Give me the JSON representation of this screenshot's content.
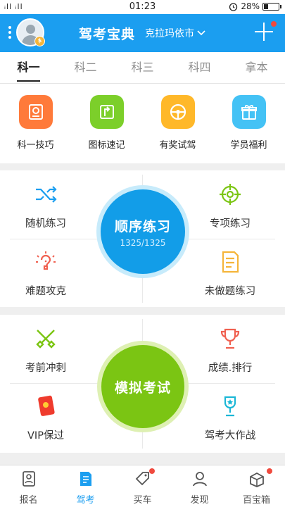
{
  "status": {
    "signal": "ᵢll ᵢll",
    "time": "01:23",
    "battery": "28%",
    "battery_level": 0.28
  },
  "header": {
    "title": "驾考宝典",
    "city": "克拉玛依市",
    "avatar_badge": "$"
  },
  "tabs": [
    {
      "label": "科一",
      "active": true
    },
    {
      "label": "科二"
    },
    {
      "label": "科三"
    },
    {
      "label": "科四"
    },
    {
      "label": "拿本"
    }
  ],
  "features": [
    {
      "label": "科一技巧",
      "icon": "book-icon",
      "color": "#ff7a3a"
    },
    {
      "label": "图标速记",
      "icon": "sign-icon",
      "color": "#7ccf2a"
    },
    {
      "label": "有奖试驾",
      "icon": "steering-icon",
      "color": "#ffb829"
    },
    {
      "label": "学员福利",
      "icon": "gift-icon",
      "color": "#44c2f5"
    }
  ],
  "practice": {
    "random": "随机练习",
    "special": "专项练习",
    "hard": "难题攻克",
    "undone": "未做题练习",
    "sequential": "顺序练习",
    "progress": "1325/1325"
  },
  "exam": {
    "sprint": "考前冲刺",
    "ranking": "成绩.排行",
    "vip": "VIP保过",
    "battle": "驾考大作战",
    "mock": "模拟考试"
  },
  "nav": [
    {
      "label": "报名"
    },
    {
      "label": "驾考",
      "active": true
    },
    {
      "label": "买车"
    },
    {
      "label": "发现"
    },
    {
      "label": "百宝箱"
    }
  ],
  "colors": {
    "brand": "#1b9ef0",
    "green": "#7bc513",
    "badge": "#f04a3e"
  }
}
